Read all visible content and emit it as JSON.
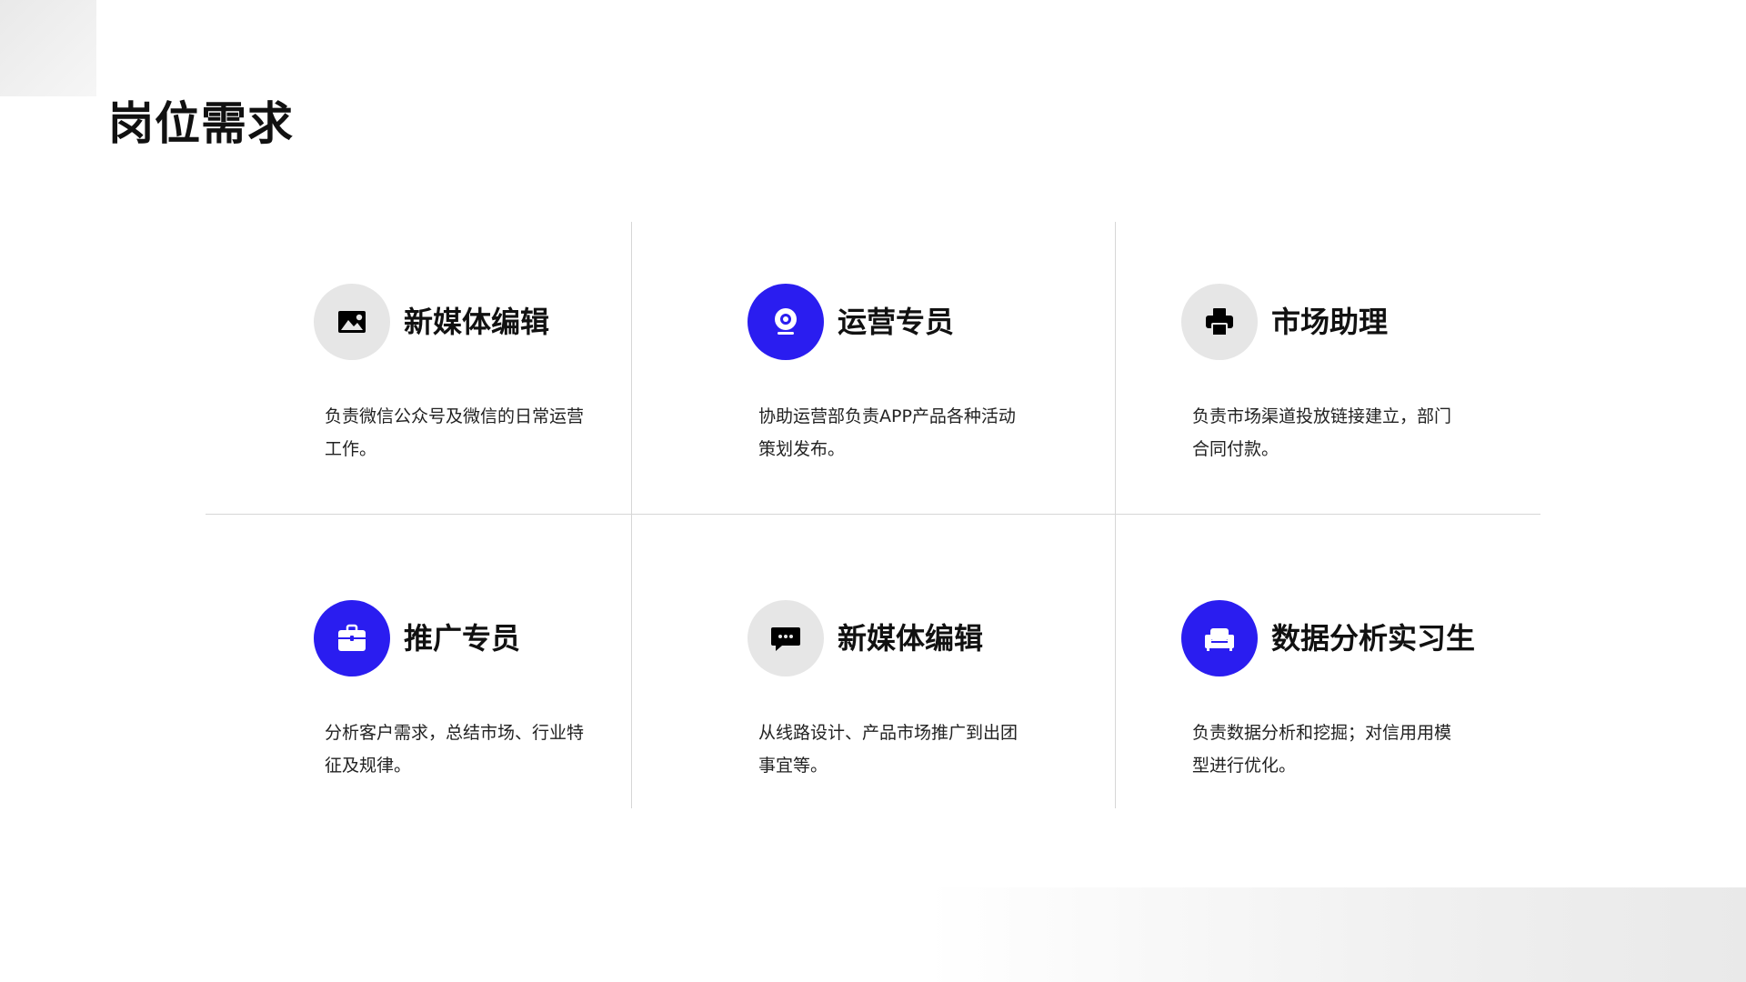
{
  "page": {
    "title": "岗位需求"
  },
  "colors": {
    "accent": "#2a1df0",
    "icon_bg_grey": "#e6e6e6",
    "divider": "#d6d6d6"
  },
  "roles": [
    {
      "title": "新媒体编辑",
      "desc": "负责微信公众号及微信的日常运营工作。",
      "icon": "image-icon",
      "icon_style": "grey"
    },
    {
      "title": "运营专员",
      "desc": "协助运营部负责APP产品各种活动策划发布。",
      "icon": "webcam-icon",
      "icon_style": "blue"
    },
    {
      "title": "市场助理",
      "desc": "负责市场渠道投放链接建立，部门合同付款。",
      "icon": "printer-icon",
      "icon_style": "grey"
    },
    {
      "title": "推广专员",
      "desc": "分析客户需求，总结市场、行业特征及规律。",
      "icon": "briefcase-icon",
      "icon_style": "blue"
    },
    {
      "title": "新媒体编辑",
      "desc": "从线路设计、产品市场推广到出团事宜等。",
      "icon": "chat-icon",
      "icon_style": "grey"
    },
    {
      "title": "数据分析实习生",
      "desc": "负责数据分析和挖掘；对信用用模型进行优化。",
      "icon": "sofa-icon",
      "icon_style": "blue"
    }
  ]
}
